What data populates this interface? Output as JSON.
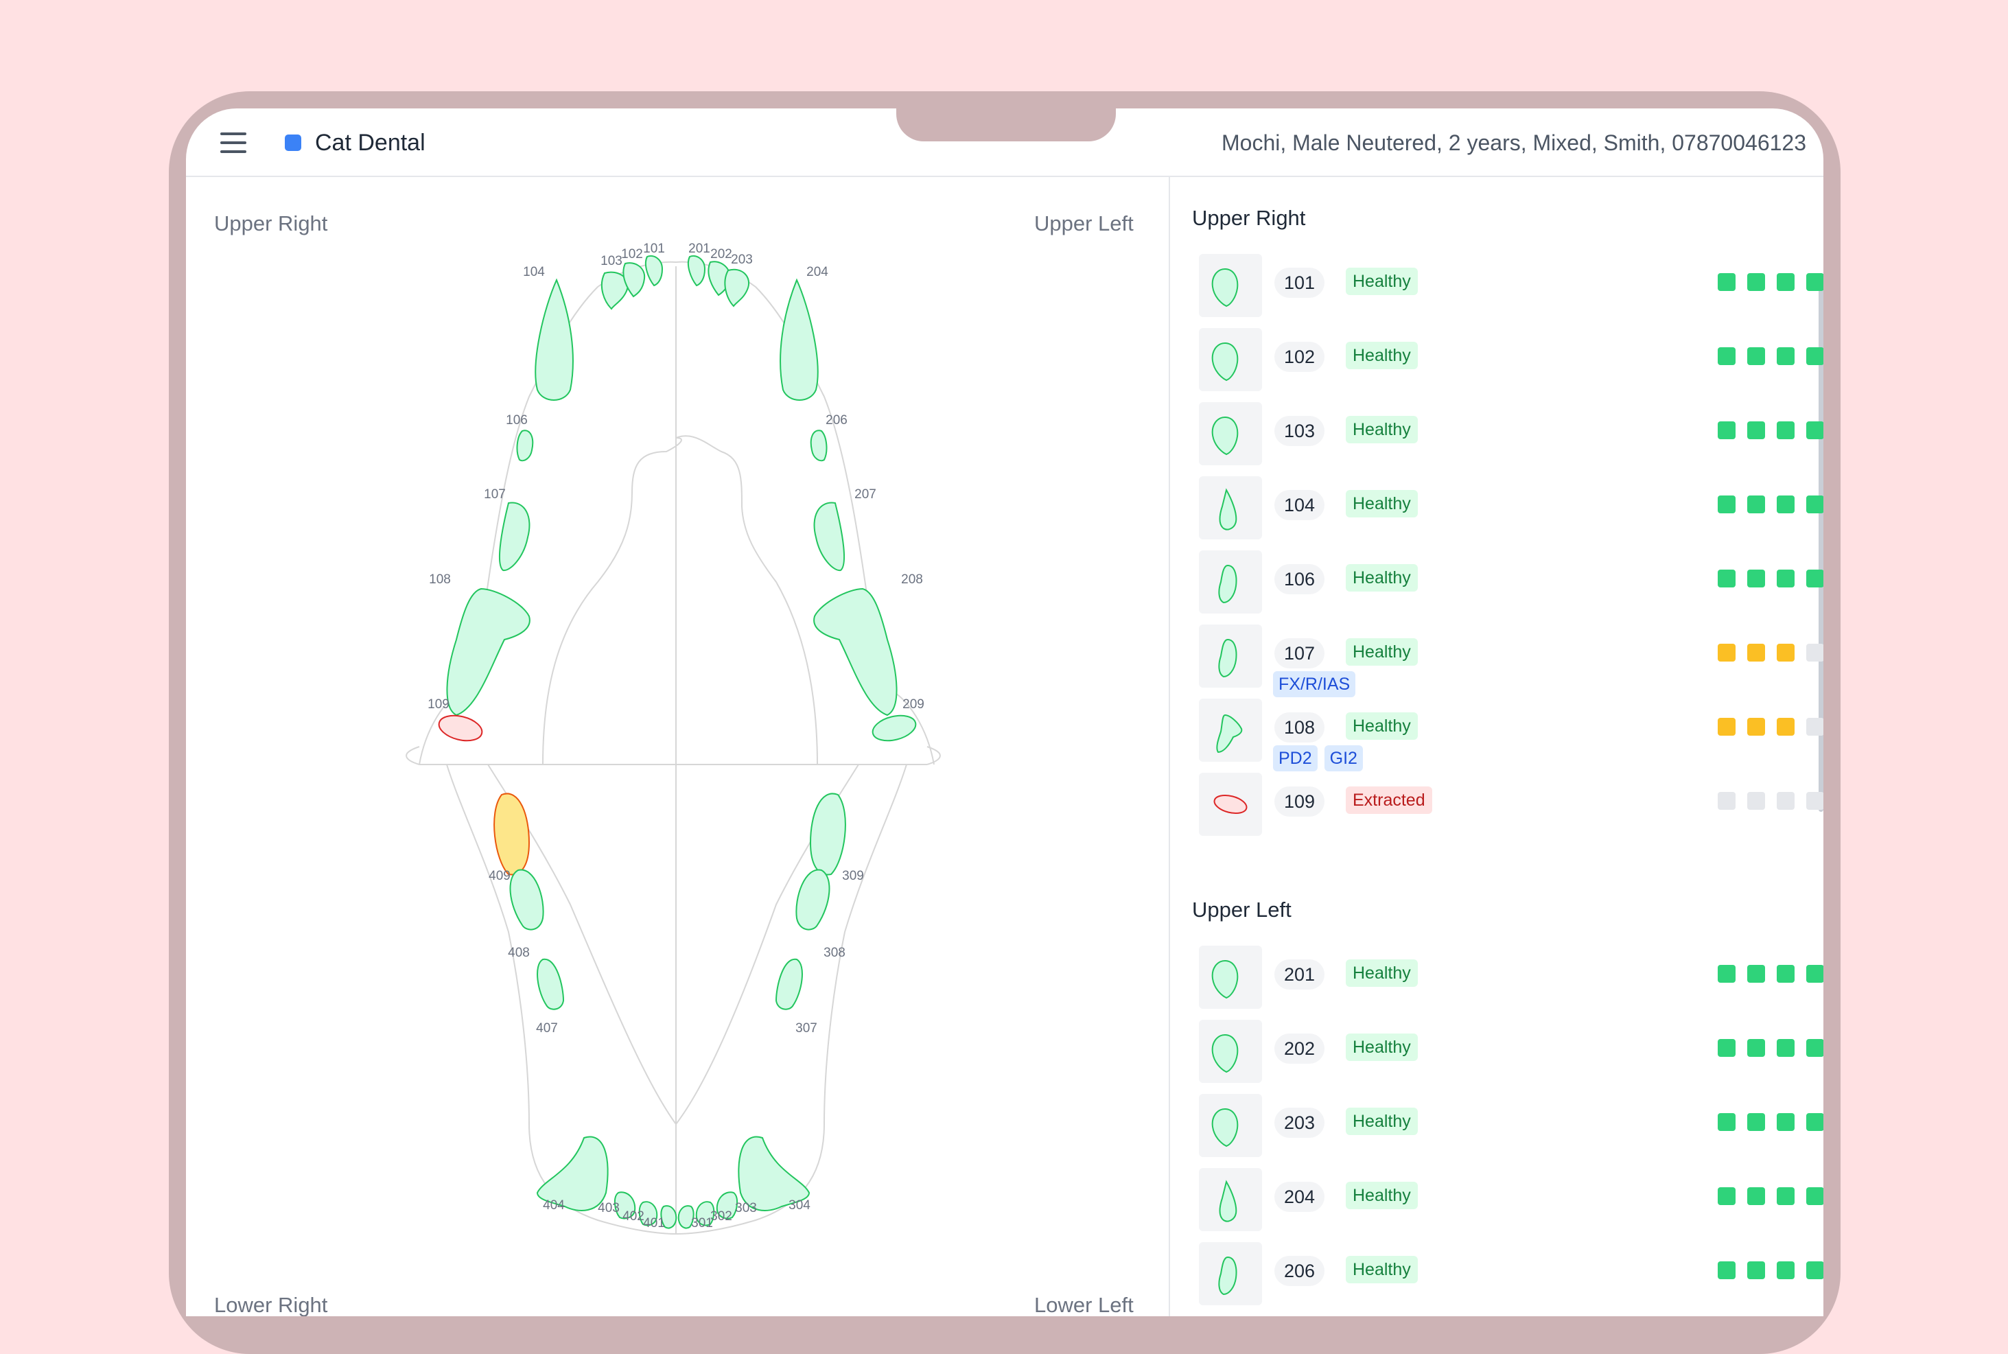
{
  "app": {
    "title": "Cat Dental",
    "brand_color": "#3b82f6"
  },
  "patient_info": "Mochi, Male Neutered, 2 years, Mixed, Smith, 07870046123",
  "chart": {
    "quadrants": {
      "upper_right": "Upper Right",
      "upper_left": "Upper Left",
      "lower_right": "Lower Right",
      "lower_left": "Lower Left"
    },
    "condition_colors": {
      "healthy": "#d1fae5",
      "healthy_stroke": "#22c55e",
      "attention": "#fde68a",
      "attention_stroke": "#ea580c",
      "extracted_stroke": "#dc2626"
    },
    "tooth_labels": [
      "104",
      "103",
      "102",
      "101",
      "201",
      "202",
      "203",
      "204",
      "106",
      "206",
      "107",
      "207",
      "108",
      "208",
      "109",
      "209",
      "409",
      "309",
      "408",
      "308",
      "407",
      "307",
      "404",
      "403",
      "402",
      "401",
      "301",
      "302",
      "303",
      "304"
    ]
  },
  "panel": {
    "sections": [
      {
        "title": "Upper Right",
        "teeth": [
          {
            "number": "101",
            "status": "Healthy",
            "status_type": "healthy",
            "tags": [],
            "scores": [
              "g",
              "g",
              "g",
              "g",
              "e"
            ],
            "icon": "incisor-icon"
          },
          {
            "number": "102",
            "status": "Healthy",
            "status_type": "healthy",
            "tags": [],
            "scores": [
              "g",
              "g",
              "g",
              "g",
              "g"
            ],
            "icon": "incisor-icon"
          },
          {
            "number": "103",
            "status": "Healthy",
            "status_type": "healthy",
            "tags": [],
            "scores": [
              "g",
              "g",
              "g",
              "g",
              "e"
            ],
            "icon": "incisor-icon"
          },
          {
            "number": "104",
            "status": "Healthy",
            "status_type": "healthy",
            "tags": [],
            "scores": [
              "g",
              "g",
              "g",
              "g",
              "e"
            ],
            "icon": "canine-icon"
          },
          {
            "number": "106",
            "status": "Healthy",
            "status_type": "healthy",
            "tags": [],
            "scores": [
              "g",
              "g",
              "g",
              "g",
              "g"
            ],
            "icon": "premolar-icon"
          },
          {
            "number": "107",
            "status": "Healthy",
            "status_type": "healthy",
            "tags": [
              "FX/R/IAS"
            ],
            "scores": [
              "y",
              "y",
              "y",
              "e",
              "e"
            ],
            "icon": "premolar-icon"
          },
          {
            "number": "108",
            "status": "Healthy",
            "status_type": "healthy",
            "tags": [
              "PD2",
              "GI2"
            ],
            "scores": [
              "y",
              "y",
              "y",
              "e",
              "e"
            ],
            "icon": "carnassial-icon"
          },
          {
            "number": "109",
            "status": "Extracted",
            "status_type": "extracted",
            "tags": [],
            "scores": [
              "e",
              "e",
              "e",
              "e",
              "e"
            ],
            "icon": "molar-icon"
          }
        ]
      },
      {
        "title": "Upper Left",
        "teeth": [
          {
            "number": "201",
            "status": "Healthy",
            "status_type": "healthy",
            "tags": [],
            "scores": [
              "g",
              "g",
              "g",
              "g",
              "e"
            ],
            "icon": "incisor-icon"
          },
          {
            "number": "202",
            "status": "Healthy",
            "status_type": "healthy",
            "tags": [],
            "scores": [
              "g",
              "g",
              "g",
              "g",
              "e"
            ],
            "icon": "incisor-icon"
          },
          {
            "number": "203",
            "status": "Healthy",
            "status_type": "healthy",
            "tags": [],
            "scores": [
              "g",
              "g",
              "g",
              "g",
              "g"
            ],
            "icon": "incisor-icon"
          },
          {
            "number": "204",
            "status": "Healthy",
            "status_type": "healthy",
            "tags": [],
            "scores": [
              "g",
              "g",
              "g",
              "g",
              "e"
            ],
            "icon": "canine-icon"
          },
          {
            "number": "206",
            "status": "Healthy",
            "status_type": "healthy",
            "tags": [],
            "scores": [
              "g",
              "g",
              "g",
              "g",
              "e"
            ],
            "icon": "premolar-icon"
          }
        ]
      }
    ],
    "score_colors": {
      "g": "#2fd37a",
      "y": "#fbbf24",
      "e": "#e5e7eb"
    }
  }
}
